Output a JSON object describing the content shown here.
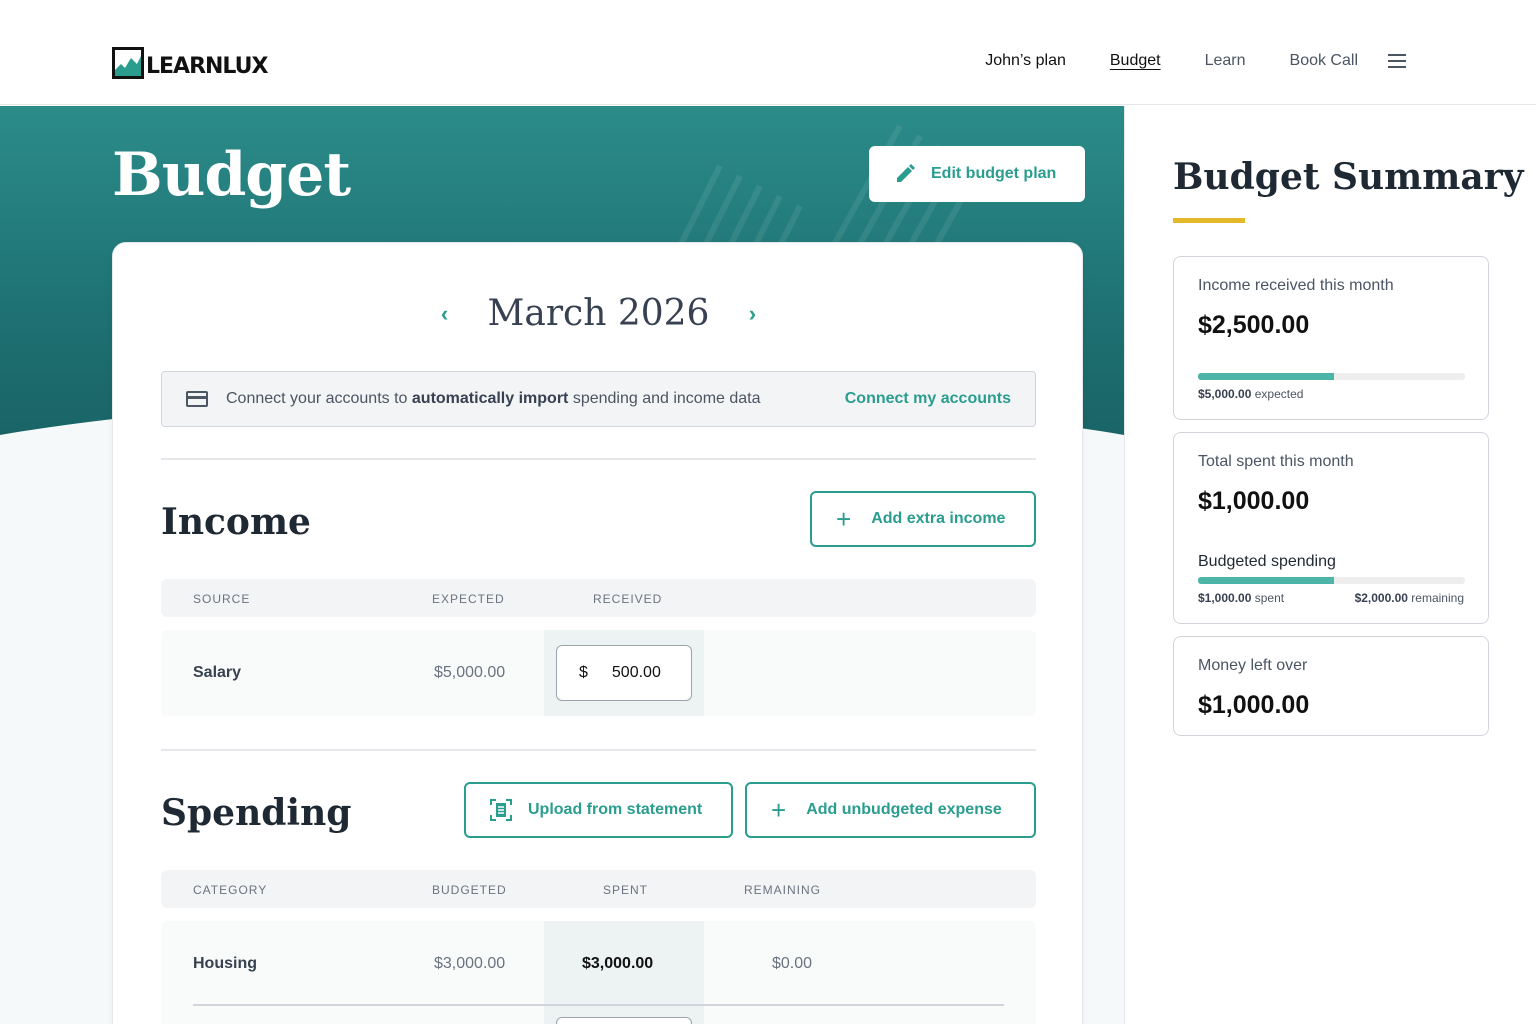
{
  "nav": {
    "logo_text": "LEARNLUX",
    "links": [
      "John’s plan",
      "Budget",
      "Learn",
      "Book Call"
    ]
  },
  "hero": {
    "title": "Budget",
    "edit_button": "Edit budget plan"
  },
  "month": {
    "label": "March 2026"
  },
  "connect": {
    "text_before": "Connect your accounts to ",
    "text_bold": "automatically import",
    "text_after": " spending and income data",
    "link": "Connect my accounts"
  },
  "income": {
    "title": "Income",
    "add_button": "Add extra income",
    "headers": [
      "SOURCE",
      "EXPECTED",
      "RECEIVED"
    ],
    "rows": [
      {
        "source": "Salary",
        "expected": "$5,000.00",
        "currency": "$",
        "received": "500.00"
      }
    ]
  },
  "spending": {
    "title": "Spending",
    "upload_button": "Upload from statement",
    "add_button": "Add unbudgeted expense",
    "headers": [
      "CATEGORY",
      "BUDGETED",
      "SPENT",
      "REMAINING"
    ],
    "rows": [
      {
        "category": "Housing",
        "budgeted": "$3,000.00",
        "spent": "$3,000.00",
        "remaining": "$0.00"
      }
    ]
  },
  "summary": {
    "title": "Budget Summary",
    "income": {
      "label": "Income received this month",
      "value": "$2,500.00",
      "progress": 0.51,
      "expected_amount": "$5,000.00",
      "expected_word": "expected"
    },
    "spent": {
      "label": "Total spent this month",
      "value": "$1,000.00",
      "sub_label": "Budgeted spending",
      "progress": 0.51,
      "spent_amount": "$1,000.00",
      "spent_word": "spent",
      "remaining_amount": "$2,000.00",
      "remaining_word": "remaining"
    },
    "left": {
      "label": "Money left over",
      "value": "$1,000.00"
    }
  },
  "colors": {
    "accent": "#2a9d8f",
    "hero": "#1d6e70",
    "highlight": "#e3b829"
  }
}
